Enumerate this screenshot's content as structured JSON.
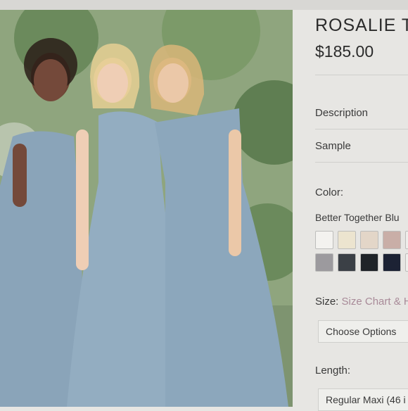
{
  "product": {
    "title": "ROSALIE T",
    "price": "$185.00"
  },
  "sections": {
    "description": "Description",
    "sample": "Sample"
  },
  "color": {
    "label": "Color:",
    "selected_name": "Better Together Blu",
    "swatches": [
      "#f3f2ef",
      "#ece4cf",
      "#e3d6c8",
      "#c9aea7",
      "#efeeeb",
      "#9c9a9e",
      "#3b4046",
      "#1f2328",
      "#1c2234",
      "#f0efec"
    ]
  },
  "size": {
    "label": "Size:",
    "link_text": "Size Chart & H",
    "select_value": "Choose Options"
  },
  "length": {
    "label": "Length:",
    "select_value": "Regular Maxi (46 i"
  },
  "colors": {
    "link": "#a88a98",
    "dress": "#8fa9be"
  }
}
